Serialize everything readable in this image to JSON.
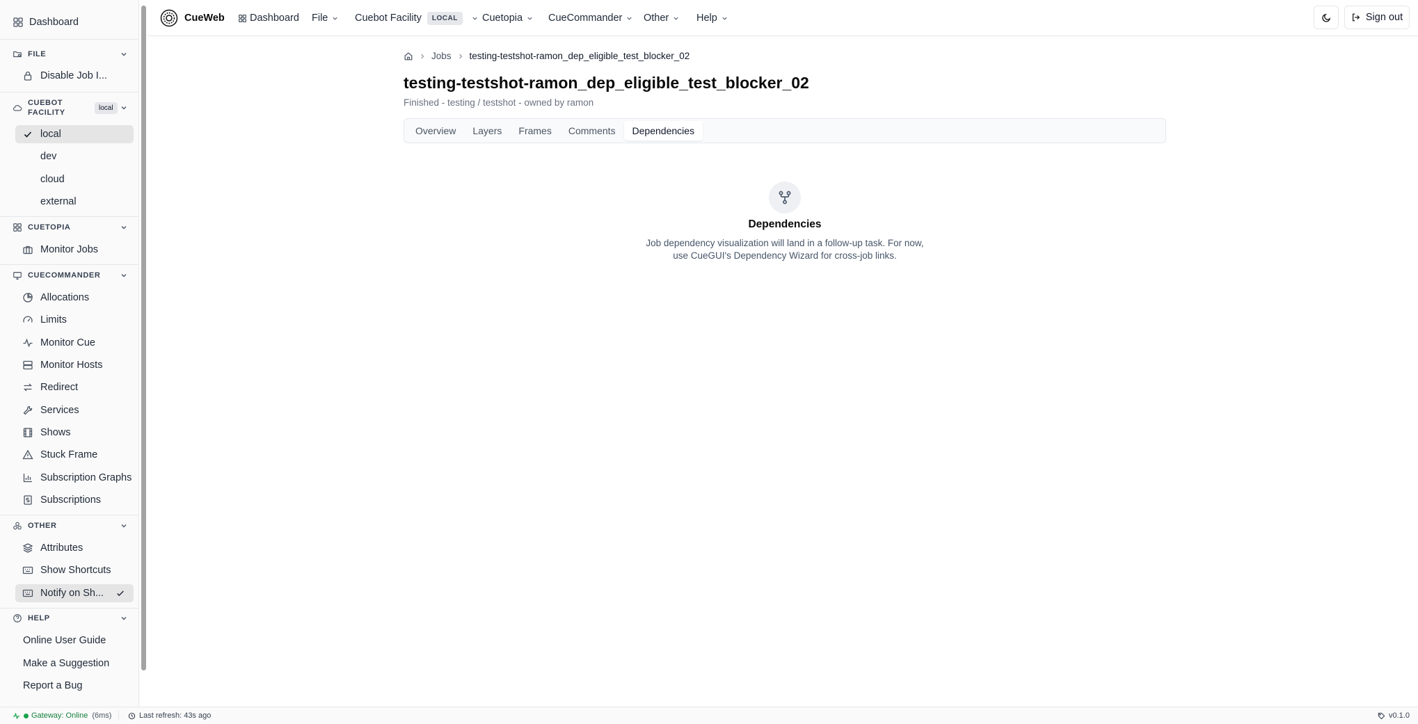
{
  "app": {
    "name": "CueWeb",
    "version": "v0.1.0"
  },
  "topbar": {
    "dashboard": "Dashboard",
    "file": "File",
    "facility": "Cuebot Facility",
    "facility_tag": "LOCAL",
    "cuetopia": "Cuetopia",
    "cuecommander": "CueCommander",
    "other": "Other",
    "help": "Help",
    "sign_out": "Sign out"
  },
  "sidebar": {
    "dashboard": "Dashboard",
    "file_header": "FILE",
    "file_items": [
      "Disable Job I..."
    ],
    "facility_header_line1": "CUEBOT",
    "facility_header_line2": "FACILITY",
    "facility_badge": "local",
    "facility_items": [
      "local",
      "dev",
      "cloud",
      "external"
    ],
    "facility_selected": "local",
    "cuetopia_header": "CUETOPIA",
    "cuetopia_items": [
      "Monitor Jobs"
    ],
    "cuecommander_header": "CUECOMMANDER",
    "cuecommander_items": [
      "Allocations",
      "Limits",
      "Monitor Cue",
      "Monitor Hosts",
      "Redirect",
      "Services",
      "Shows",
      "Stuck Frame",
      "Subscription Graphs",
      "Subscriptions"
    ],
    "other_header": "OTHER",
    "other_items": [
      "Attributes",
      "Show Shortcuts",
      "Notify on Sh..."
    ],
    "help_header": "HELP",
    "help_items": [
      "Online User Guide",
      "Make a Suggestion",
      "Report a Bug"
    ]
  },
  "breadcrumb": {
    "jobs": "Jobs",
    "current": "testing-testshot-ramon_dep_eligible_test_blocker_02"
  },
  "job": {
    "title": "testing-testshot-ramon_dep_eligible_test_blocker_02",
    "subtitle": "Finished - testing / testshot - owned by ramon"
  },
  "tabs": [
    "Overview",
    "Layers",
    "Frames",
    "Comments",
    "Dependencies"
  ],
  "active_tab": "Dependencies",
  "empty_state": {
    "icon": "git-fork-icon",
    "title": "Dependencies",
    "line1": "Job dependency visualization will land in a follow-up task. For now,",
    "line2": "use CueGUI's Dependency Wizard for cross-job links."
  },
  "status": {
    "gateway": "Gateway: Online",
    "latency": "(6ms)",
    "refresh": "Last refresh: 43s ago"
  },
  "colors": {
    "online": "#16a34a",
    "active_bg": "#e5e5e5"
  }
}
